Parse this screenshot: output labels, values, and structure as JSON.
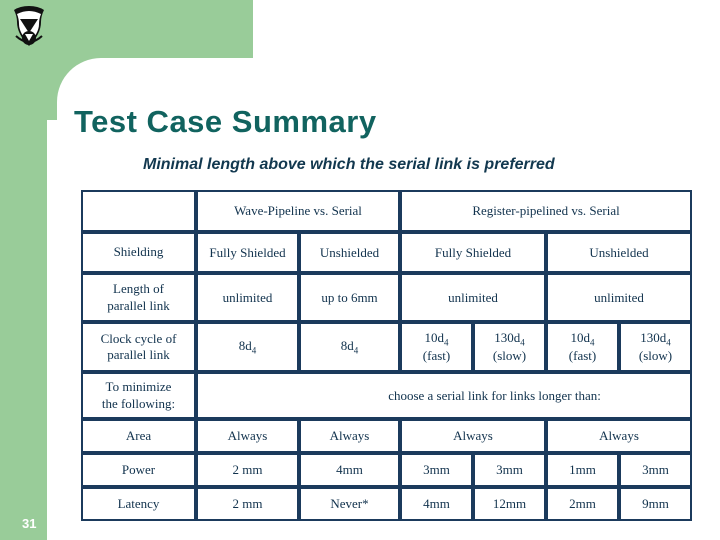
{
  "slide": {
    "page_number": "31",
    "title": "Test Case Summary",
    "subtitle": "Minimal length above which the serial link is preferred",
    "logo_icon": "institution-crest-logo",
    "colors": {
      "accent_green": "#99cc99",
      "title_teal": "#11635f",
      "table_border_navy": "#1b3a5c",
      "cell_yellow": "#e6e08a",
      "cell_yellow_light": "#ece79b",
      "cell_yellow_dark": "#e0db6e",
      "value_orange": "#d09a4e"
    }
  },
  "table": {
    "group_headers": {
      "corner": "",
      "wave": "Wave-Pipeline vs. Serial",
      "register": "Register-pipelined vs. Serial"
    },
    "rows": {
      "shielding": {
        "label": "Shielding",
        "wave_fully": "Fully Shielded",
        "wave_un": "Unshielded",
        "reg_fully": "Fully Shielded",
        "reg_un": "Unshielded"
      },
      "length": {
        "label_line1": "Length of",
        "label_line2": "parallel link",
        "wave_fully": "unlimited",
        "wave_un": "up to 6mm",
        "reg_fully": "unlimited",
        "reg_un": "unlimited"
      },
      "clock": {
        "label_line1": "Clock cycle of",
        "label_line2": "parallel link",
        "wave_fully": "8d",
        "wave_fully_sub": "4",
        "wave_un": "8d",
        "wave_un_sub": "4",
        "reg_fully_fast_v": "10d",
        "reg_fully_fast_sub": "4",
        "reg_fully_fast_q": "(fast)",
        "reg_fully_slow_v": "130d",
        "reg_fully_slow_sub": "4",
        "reg_fully_slow_q": "(slow)",
        "reg_un_fast_v": "10d",
        "reg_un_fast_sub": "4",
        "reg_un_fast_q": "(fast)",
        "reg_un_slow_v": "130d",
        "reg_un_slow_sub": "4",
        "reg_un_slow_q": "(slow)"
      },
      "minimize": {
        "label_line1": "To minimize",
        "label_line2": "the following:",
        "spanning_note": "choose a serial link for links longer than:"
      },
      "area": {
        "label": "Area",
        "wave_fully": "Always",
        "wave_un": "Always",
        "reg_fully": "Always",
        "reg_un": "Always"
      },
      "power": {
        "label": "Power",
        "wave_fully": "2 mm",
        "wave_un": "4mm",
        "reg_fully_fast": "3mm",
        "reg_fully_slow": "3mm",
        "reg_un_fast": "1mm",
        "reg_un_slow": "3mm"
      },
      "latency": {
        "label": "Latency",
        "wave_fully": "2 mm",
        "wave_un": "Never*",
        "reg_fully_fast": "4mm",
        "reg_fully_slow": "12mm",
        "reg_un_fast": "2mm",
        "reg_un_slow": "9mm"
      }
    }
  }
}
